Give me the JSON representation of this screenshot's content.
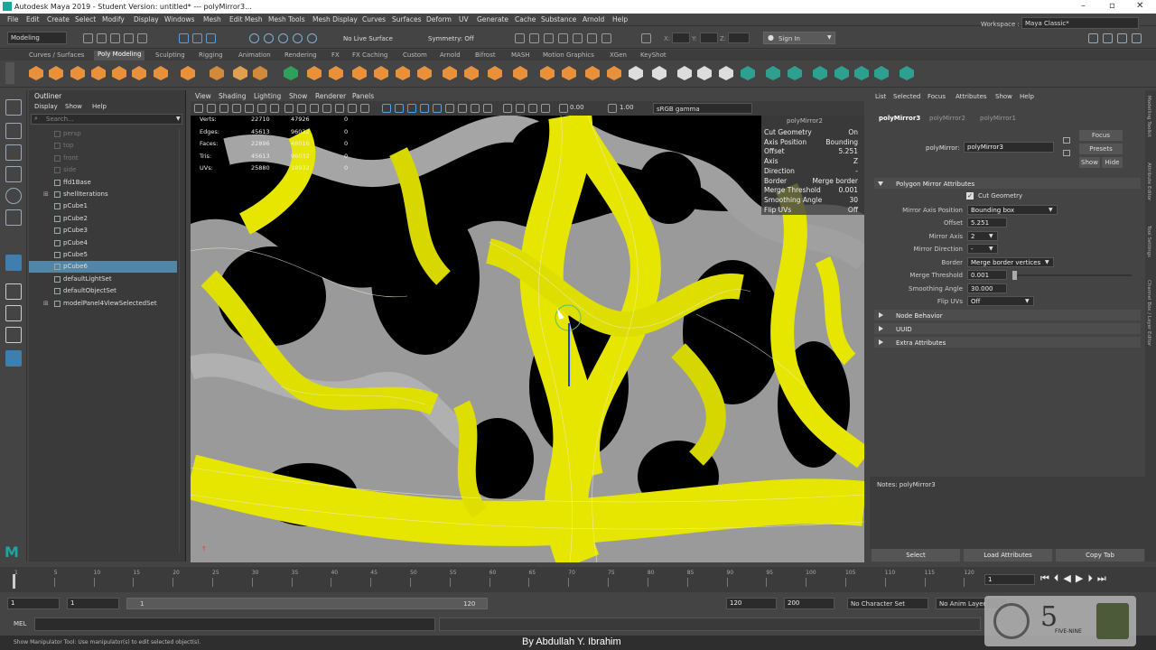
{
  "window": {
    "title": "Autodesk Maya 2019 - Student Version: untitled*  ---  polyMirror3..."
  },
  "menu": [
    "File",
    "Edit",
    "Create",
    "Select",
    "Modify",
    "Display",
    "Windows",
    "Mesh",
    "Edit Mesh",
    "Mesh Tools",
    "Mesh Display",
    "Curves",
    "Surfaces",
    "Deform",
    "UV",
    "Generate",
    "Cache",
    "Substance",
    "Arnold",
    "Help"
  ],
  "status": {
    "mode": "Modeling",
    "live_surface": "No Live Surface",
    "symmetry": "Symmetry: Off",
    "x_label": "X:",
    "y_label": "Y:",
    "z_label": "Z:",
    "sign_in": "Sign In",
    "workspace_label": "Workspace :",
    "workspace": "Maya Classic*"
  },
  "shelf_tabs": [
    "Curves / Surfaces",
    "Poly Modeling",
    "Sculpting",
    "Rigging",
    "Animation",
    "Rendering",
    "FX",
    "FX Caching",
    "Custom",
    "Arnold",
    "Bifrost",
    "MASH",
    "Motion Graphics",
    "XGen",
    "KeyShot"
  ],
  "shelf_active": "Poly Modeling",
  "outliner": {
    "title": "Outliner",
    "menu": [
      "Display",
      "Show",
      "Help"
    ],
    "search_placeholder": "Search...",
    "items": [
      {
        "label": "persp",
        "dim": true
      },
      {
        "label": "top",
        "dim": true
      },
      {
        "label": "front",
        "dim": true
      },
      {
        "label": "side",
        "dim": true
      },
      {
        "label": "ffd1Base",
        "dim": false
      },
      {
        "label": "shellIterations",
        "dim": false
      },
      {
        "label": "pCube1",
        "dim": false
      },
      {
        "label": "pCube2",
        "dim": false
      },
      {
        "label": "pCube3",
        "dim": false
      },
      {
        "label": "pCube4",
        "dim": false
      },
      {
        "label": "pCube5",
        "dim": false
      },
      {
        "label": "pCube6",
        "dim": false,
        "selected": true
      },
      {
        "label": "defaultLightSet",
        "dim": false
      },
      {
        "label": "defaultObjectSet",
        "dim": false
      },
      {
        "label": "modelPanel4ViewSelectedSet",
        "dim": false
      }
    ]
  },
  "viewport": {
    "menu": [
      "View",
      "Shading",
      "Lighting",
      "Show",
      "Renderer",
      "Panels"
    ],
    "exposure": "0.00",
    "gamma": "1.00",
    "color_space": "sRGB gamma",
    "hud_rows": [
      {
        "label": "Verts:",
        "a": "22710",
        "b": "47926",
        "c": "0"
      },
      {
        "label": "Edges:",
        "a": "45613",
        "b": "96032",
        "c": "0"
      },
      {
        "label": "Faces:",
        "a": "22896",
        "b": "48016",
        "c": "0"
      },
      {
        "label": "Tris:",
        "a": "45613",
        "b": "96032",
        "c": "0"
      },
      {
        "label": "UVs:",
        "a": "25880",
        "b": "18932",
        "c": "0"
      }
    ],
    "channel_title": "polyMirror2",
    "channels": [
      {
        "label": "Cut Geometry",
        "value": "On"
      },
      {
        "label": "Axis Position",
        "value": "Bounding"
      },
      {
        "label": "Offset",
        "value": "5.251"
      },
      {
        "label": "Axis",
        "value": "Z"
      },
      {
        "label": "Direction",
        "value": "-"
      },
      {
        "label": "Border",
        "value": "Merge border"
      },
      {
        "label": "Merge Threshold",
        "value": "0.001"
      },
      {
        "label": "Smoothing Angle",
        "value": "30"
      },
      {
        "label": "Flip UVs",
        "value": "Off"
      }
    ]
  },
  "attr_editor": {
    "menu": [
      "List",
      "Selected",
      "Focus",
      "Attributes",
      "Show",
      "Help"
    ],
    "tabs": [
      "polyMirror3",
      "polyMirror2",
      "polyMirror1"
    ],
    "node_label": "polyMirror:",
    "node_value": "polyMirror3",
    "focus": "Focus",
    "presets": "Presets",
    "show": "Show",
    "hide": "Hide",
    "section": "Polygon Mirror Attributes",
    "cut_geometry": "Cut Geometry",
    "rows": [
      {
        "label": "Mirror Axis Position",
        "value": "Bounding box",
        "type": "drop"
      },
      {
        "label": "Offset",
        "value": "5.251",
        "type": "field"
      },
      {
        "label": "Mirror Axis",
        "value": "2",
        "type": "drop"
      },
      {
        "label": "Mirror Direction",
        "value": "-",
        "type": "drop"
      },
      {
        "label": "Border",
        "value": "Merge border vertices",
        "type": "drop"
      },
      {
        "label": "Merge Threshold",
        "value": "0.001",
        "type": "slider"
      },
      {
        "label": "Smoothing Angle",
        "value": "30.000",
        "type": "field"
      },
      {
        "label": "Flip UVs",
        "value": "Off",
        "type": "drop"
      }
    ],
    "closed_sections": [
      "Node Behavior",
      "UUID",
      "Extra Attributes"
    ],
    "notes": "Notes:  polyMirror3",
    "buttons": [
      "Select",
      "Load Attributes",
      "Copy Tab"
    ]
  },
  "side_tabs": [
    "Modelling Toolkit",
    "Attribute Editor",
    "Tool Settings",
    "Channel Box / Layer Editor"
  ],
  "timeline": {
    "ticks": [
      "1",
      "5",
      "10",
      "15",
      "20",
      "25",
      "30",
      "35",
      "40",
      "45",
      "50",
      "55",
      "60",
      "65",
      "70",
      "75",
      "80",
      "85",
      "90",
      "95",
      "100",
      "105",
      "110",
      "115",
      "120"
    ],
    "current": "1"
  },
  "range": {
    "start": "1",
    "inner_start": "1",
    "slider_start": "1",
    "slider_end": "120",
    "end": "120",
    "anim_end": "200",
    "char_set": "No Character Set",
    "anim_layer": "No Anim Layer"
  },
  "cmd": {
    "label": "MEL"
  },
  "help_line": "Show Manipulator Tool: Use manipulator(s) to edit selected object(s).",
  "credit": "By Abdullah Y. Ibrahim",
  "watermark_text": "FIVE-NINE"
}
